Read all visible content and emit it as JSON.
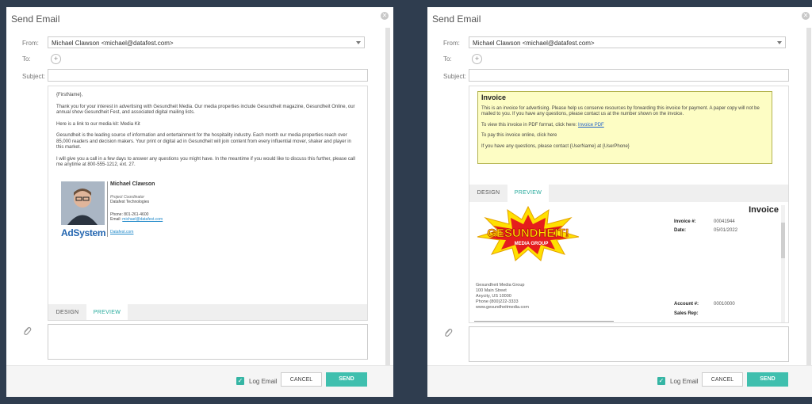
{
  "left_dialog": {
    "title": "Send Email",
    "from_label": "From:",
    "from_value": "Michael Clawson <michael@datafest.com>",
    "to_label": "To:",
    "subject_label": "Subject:",
    "body_paragraphs": [
      "{FirstName},",
      "Thank you for your interest in advertising with Gesundheit Media. Our media properties include Gesundheit magazine, Gesundheit Online, our annual show Gesundheit Fest, and associated digital mailing lists.",
      "Here is a link to our media kit: Media Kit",
      "Gesundheit is the leading source of information and entertainment for the hospitality industry. Each month our media properties reach over 85,000 readers and decision makers. Your print or digital ad in Gesundheit will join content from every influential mover, shaker and player in this market.",
      "I will give you a call in a few days to answer any questions you might have. In the meantime if you would like to discuss this further, please call me anytime at 800-555-1212, ext. 27."
    ],
    "signature": {
      "name": "Michael Clawson",
      "role": "Project Coordinator",
      "company": "Datafest Technologies",
      "phone": "Phone: 801-261-4600",
      "email_label": "Email:",
      "email": "michael@datafest.com",
      "website": "Datafest.com",
      "logo_text": "AdSystem"
    },
    "tabs": {
      "design": "DESIGN",
      "preview": "PREVIEW"
    },
    "log_email_label": "Log Email",
    "cancel_label": "CANCEL",
    "send_label": "SEND"
  },
  "right_dialog": {
    "title": "Send Email",
    "from_label": "From:",
    "from_value": "Michael Clawson <michael@datafest.com>",
    "to_label": "To:",
    "subject_label": "Subject:",
    "invoice_box": {
      "heading": "Invoice",
      "p1": "This is an invoice for advertising. Please help us conserve resources by forwarding this invoice for payment. A paper copy will not be mailed to you. If you have any questions, please contact us at the number shown on the invoice.",
      "p2_prefix": "To view this invoice in PDF format, click here:",
      "p2_link": "Invoice PDF",
      "p3": "To pay this invoice online, click here",
      "p4": "If you have any questions, please contact {UserName} at {UserPhone}"
    },
    "tabs": {
      "design": "DESIGN",
      "preview": "PREVIEW"
    },
    "preview": {
      "title": "Invoice",
      "logo_text_1": "GESUNDHEIT!",
      "logo_text_2": "MEDIA GROUP",
      "invoice_no_label": "Invoice #:",
      "invoice_no": "00041944",
      "date_label": "Date:",
      "date": "05/01/2022",
      "account_label": "Account #:",
      "account": "00010000",
      "sales_rep_label": "Sales Rep:",
      "company_lines": [
        "Gesundheit Media Group",
        "100 Main Street",
        "Anycity, US 10000",
        "Phone (800)222-3333",
        "www.gesundheitmedia.com"
      ]
    },
    "log_email_label": "Log Email",
    "cancel_label": "CANCEL",
    "send_label": "SEND"
  },
  "colors": {
    "accent": "#3fbfae",
    "preview_tab": "#25aa9c",
    "invoice_bg": "#fdfdc4",
    "backdrop": "#2f3d4f"
  }
}
